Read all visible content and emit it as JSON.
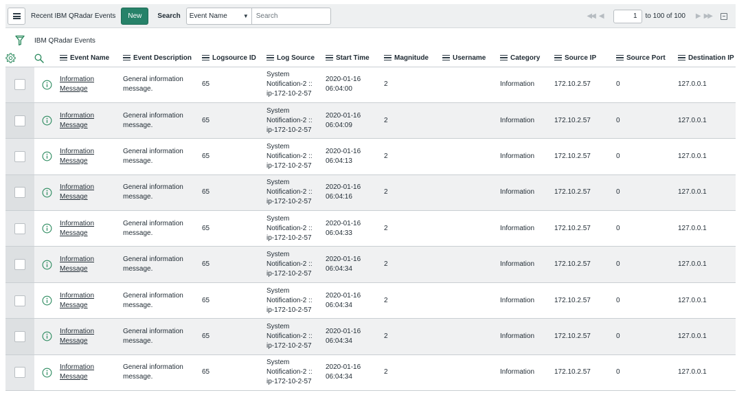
{
  "toolbar": {
    "list_title": "Recent IBM QRadar Events",
    "new_label": "New",
    "search_label": "Search",
    "search_field": "Event Name",
    "search_placeholder": "Search"
  },
  "pagination": {
    "page_value": "1",
    "range_label": "to 100 of 100"
  },
  "breadcrumb": "IBM QRadar Events",
  "icons": {
    "filter": "filter-icon",
    "settings": "gear-icon",
    "search": "search-icon",
    "row": "info-circle-icon"
  },
  "colors": {
    "accent": "#278269",
    "row_alt": "#f0f1f2",
    "icon_green": "#2b8a5e"
  },
  "columns": [
    "Event Name",
    "Event Description",
    "Logsource ID",
    "Log Source",
    "Start Time",
    "Magnitude",
    "Username",
    "Category",
    "Source IP",
    "Source Port",
    "Destination IP"
  ],
  "rows": [
    {
      "event_name": "Information Message",
      "event_description": "General information message.",
      "logsource_id": "65",
      "log_source": "System Notification-2 :: ip-172-10-2-57",
      "start_time": "2020-01-16 06:04:00",
      "magnitude": "2",
      "username": "",
      "category": "Information",
      "source_ip": "172.10.2.57",
      "source_port": "0",
      "destination_ip": "127.0.0.1"
    },
    {
      "event_name": "Information Message",
      "event_description": "General information message.",
      "logsource_id": "65",
      "log_source": "System Notification-2 :: ip-172-10-2-57",
      "start_time": "2020-01-16 06:04:09",
      "magnitude": "2",
      "username": "",
      "category": "Information",
      "source_ip": "172.10.2.57",
      "source_port": "0",
      "destination_ip": "127.0.0.1"
    },
    {
      "event_name": "Information Message",
      "event_description": "General information message.",
      "logsource_id": "65",
      "log_source": "System Notification-2 :: ip-172-10-2-57",
      "start_time": "2020-01-16 06:04:13",
      "magnitude": "2",
      "username": "",
      "category": "Information",
      "source_ip": "172.10.2.57",
      "source_port": "0",
      "destination_ip": "127.0.0.1"
    },
    {
      "event_name": "Information Message",
      "event_description": "General information message.",
      "logsource_id": "65",
      "log_source": "System Notification-2 :: ip-172-10-2-57",
      "start_time": "2020-01-16 06:04:16",
      "magnitude": "2",
      "username": "",
      "category": "Information",
      "source_ip": "172.10.2.57",
      "source_port": "0",
      "destination_ip": "127.0.0.1"
    },
    {
      "event_name": "Information Message",
      "event_description": "General information message.",
      "logsource_id": "65",
      "log_source": "System Notification-2 :: ip-172-10-2-57",
      "start_time": "2020-01-16 06:04:33",
      "magnitude": "2",
      "username": "",
      "category": "Information",
      "source_ip": "172.10.2.57",
      "source_port": "0",
      "destination_ip": "127.0.0.1"
    },
    {
      "event_name": "Information Message",
      "event_description": "General information message.",
      "logsource_id": "65",
      "log_source": "System Notification-2 :: ip-172-10-2-57",
      "start_time": "2020-01-16 06:04:34",
      "magnitude": "2",
      "username": "",
      "category": "Information",
      "source_ip": "172.10.2.57",
      "source_port": "0",
      "destination_ip": "127.0.0.1"
    },
    {
      "event_name": "Information Message",
      "event_description": "General information message.",
      "logsource_id": "65",
      "log_source": "System Notification-2 :: ip-172-10-2-57",
      "start_time": "2020-01-16 06:04:34",
      "magnitude": "2",
      "username": "",
      "category": "Information",
      "source_ip": "172.10.2.57",
      "source_port": "0",
      "destination_ip": "127.0.0.1"
    },
    {
      "event_name": "Information Message",
      "event_description": "General information message.",
      "logsource_id": "65",
      "log_source": "System Notification-2 :: ip-172-10-2-57",
      "start_time": "2020-01-16 06:04:34",
      "magnitude": "2",
      "username": "",
      "category": "Information",
      "source_ip": "172.10.2.57",
      "source_port": "0",
      "destination_ip": "127.0.0.1"
    },
    {
      "event_name": "Information Message",
      "event_description": "General information message.",
      "logsource_id": "65",
      "log_source": "System Notification-2 :: ip-172-10-2-57",
      "start_time": "2020-01-16 06:04:34",
      "magnitude": "2",
      "username": "",
      "category": "Information",
      "source_ip": "172.10.2.57",
      "source_port": "0",
      "destination_ip": "127.0.0.1"
    }
  ]
}
